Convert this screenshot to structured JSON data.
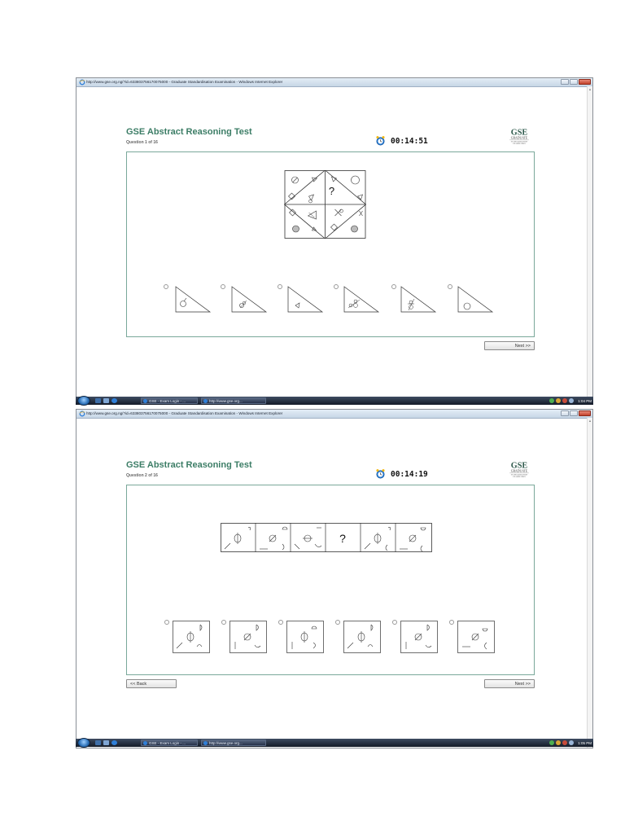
{
  "screens": [
    {
      "window_title": "http://www.gse.org.ng/?id=633803756170075000 - Graduate Standardisation Examination - Windows Internet Explorer",
      "page_title": "GSE Abstract Reasoning Test",
      "question_counter": "Question 1 of 16",
      "timer": "00:14:51",
      "puzzle_placeholder": "?",
      "next_label": "Next >>",
      "back_label": "",
      "taskbar": {
        "task1": "GSE - Exam Login - ...",
        "task2": "http://www.gse.org...",
        "clock": "1:04 PM"
      }
    },
    {
      "window_title": "http://www.gse.org.ng/?id=633803756170075000 - Graduate Standardisation Examination - Windows Internet Explorer",
      "page_title": "GSE Abstract Reasoning Test",
      "question_counter": "Question 2 of 16",
      "timer": "00:14:19",
      "puzzle_placeholder": "?",
      "next_label": "Next >>",
      "back_label": "<< Back",
      "taskbar": {
        "task1": "GSE - Exam Login - ...",
        "task2": "http://www.gse.org...",
        "clock": "1:05 PM"
      }
    }
  ],
  "logo": {
    "mark": "GSE",
    "line1": "GRADUATE",
    "line2": "STANDARDISATION",
    "line3": "EXAMINATION"
  },
  "colors": {
    "title_green": "#3c7d66",
    "panel_border": "#7aa89a",
    "taskbar_dark": "#141b27"
  },
  "icons": [
    "ie-icon",
    "clock-icon",
    "start-orb",
    "close-icon",
    "minimize-icon",
    "maximize-icon"
  ]
}
